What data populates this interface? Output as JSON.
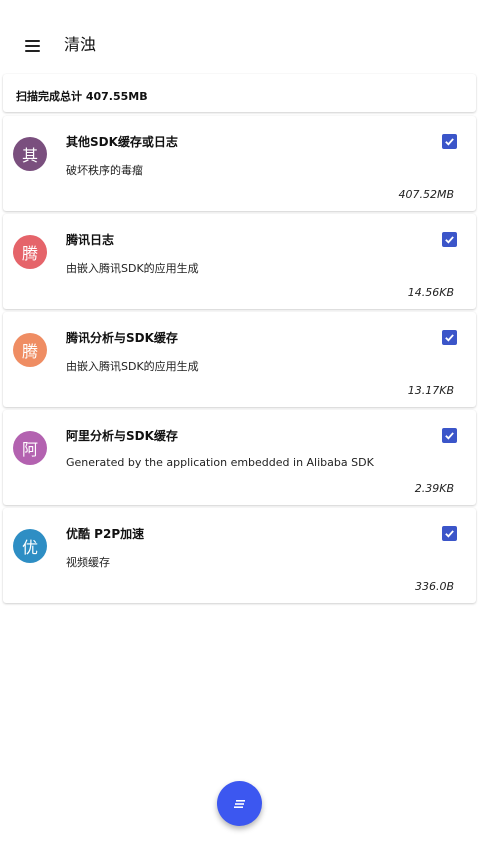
{
  "appbar": {
    "title": "清浊",
    "menu_icon": "menu-icon"
  },
  "summary": {
    "text": "扫描完成总计 407.55MB"
  },
  "colors": {
    "checkbox": "#3b55c9",
    "fab": "#3c57f0",
    "avatars": [
      "#7a4f7e",
      "#e5646a",
      "#ef8d63",
      "#b362b0",
      "#2e8ec4"
    ]
  },
  "items": [
    {
      "avatar": "其",
      "title": "其他SDK缓存或日志",
      "description": "破坏秩序的毒瘤",
      "size": "407.52MB",
      "checked": true
    },
    {
      "avatar": "腾",
      "title": "腾讯日志",
      "description": "由嵌入腾讯SDK的应用生成",
      "size": "14.56KB",
      "checked": true
    },
    {
      "avatar": "腾",
      "title": "腾讯分析与SDK缓存",
      "description": "由嵌入腾讯SDK的应用生成",
      "size": "13.17KB",
      "checked": true
    },
    {
      "avatar": "阿",
      "title": "阿里分析与SDK缓存",
      "description": "Generated by the application embedded in Alibaba SDK",
      "size": "2.39KB",
      "checked": true
    },
    {
      "avatar": "优",
      "title": "优酷 P2P加速",
      "description": "视频缓存",
      "size": "336.0B",
      "checked": true
    }
  ],
  "fab": {
    "icon": "clean-list-icon"
  }
}
